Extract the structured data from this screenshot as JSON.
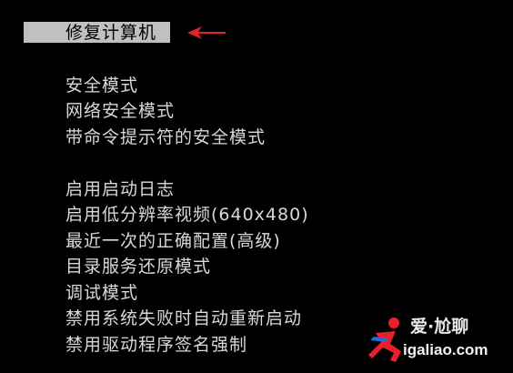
{
  "boot_menu": {
    "selected_item": "修复计算机",
    "group1": [
      "安全模式",
      "网络安全模式",
      "带命令提示符的安全模式"
    ],
    "group2": [
      "启用启动日志",
      "启用低分辨率视频(640x480)",
      "最近一次的正确配置(高级)",
      "目录服务还原模式",
      "调试模式",
      "禁用系统失败时自动重新启动",
      "禁用驱动程序签名强制"
    ]
  },
  "annotation": {
    "arrow_icon": "left-arrow-icon",
    "arrow_color": "#e8202a"
  },
  "watermark": {
    "brand_cn": "爱·尬聊",
    "url": "igaliao.com",
    "accent_color": "#1e6fd6",
    "figure_color": "#e8202a",
    "logo_icon": "running-figure-icon"
  },
  "colors": {
    "background": "#000000",
    "text": "#d8d8d8",
    "highlight": "#c0c0c0"
  }
}
